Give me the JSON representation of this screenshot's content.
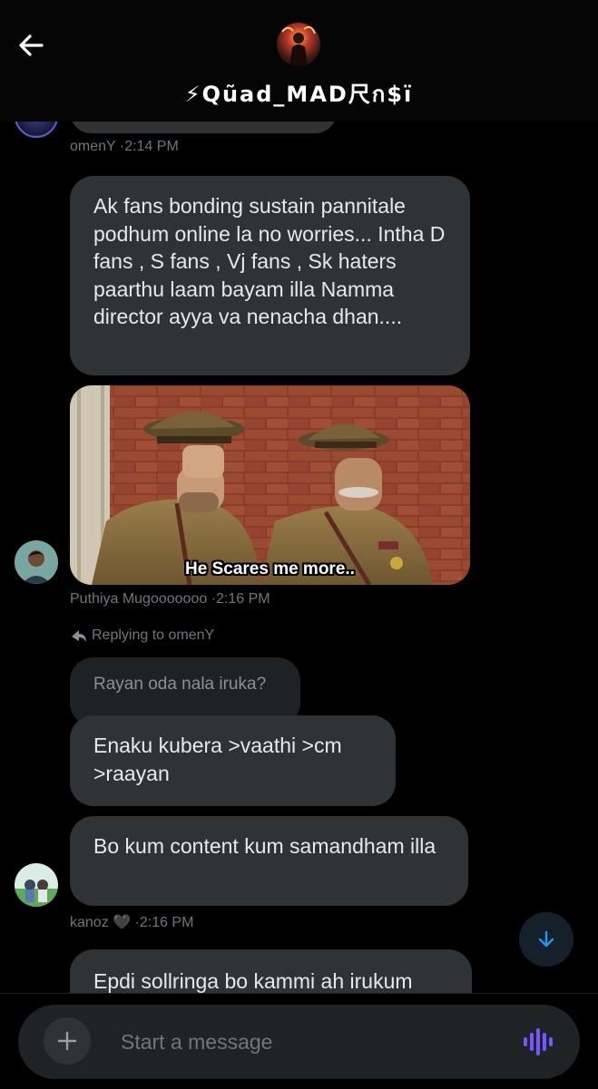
{
  "header": {
    "title": "⚡Qũad_MAD尺ก$ï"
  },
  "messages": [
    {
      "meta": {
        "name": "omenY",
        "time": "·2:14 PM"
      }
    },
    {
      "text": "Ak fans bonding sustain pannitale podhum online la no worries... Intha D fans , S fans , Vj fans , Sk haters paarthu laam bayam illa Namma director ayya va nenacha dhan...."
    },
    {
      "meme_caption": "He Scares me more..",
      "meta": {
        "name": "Puthiya Mugooooooo",
        "time": "·2:16 PM"
      }
    },
    {
      "reply_label": "Replying to omenY",
      "quoted_text": "Rayan oda nala iruka?",
      "text": "Enaku kubera >vaathi >cm >raayan"
    },
    {
      "text": "Bo kum content kum samandham illa",
      "meta": {
        "name": "kanoz 🖤",
        "time": "·2:16 PM"
      }
    },
    {
      "text": "Epdi sollringa bo kammi ah irukum"
    }
  ],
  "composer": {
    "placeholder": "Start a message"
  },
  "colors": {
    "background": "#000000",
    "bubble": "#2f3336",
    "muted_text": "#71767b",
    "accent_voice": "#7856ff",
    "accent_blue": "#1d9bf0"
  },
  "icons": [
    "back-arrow-icon",
    "plus-icon",
    "voice-wave-icon",
    "arrow-down-icon",
    "reply-arrow-icon"
  ]
}
